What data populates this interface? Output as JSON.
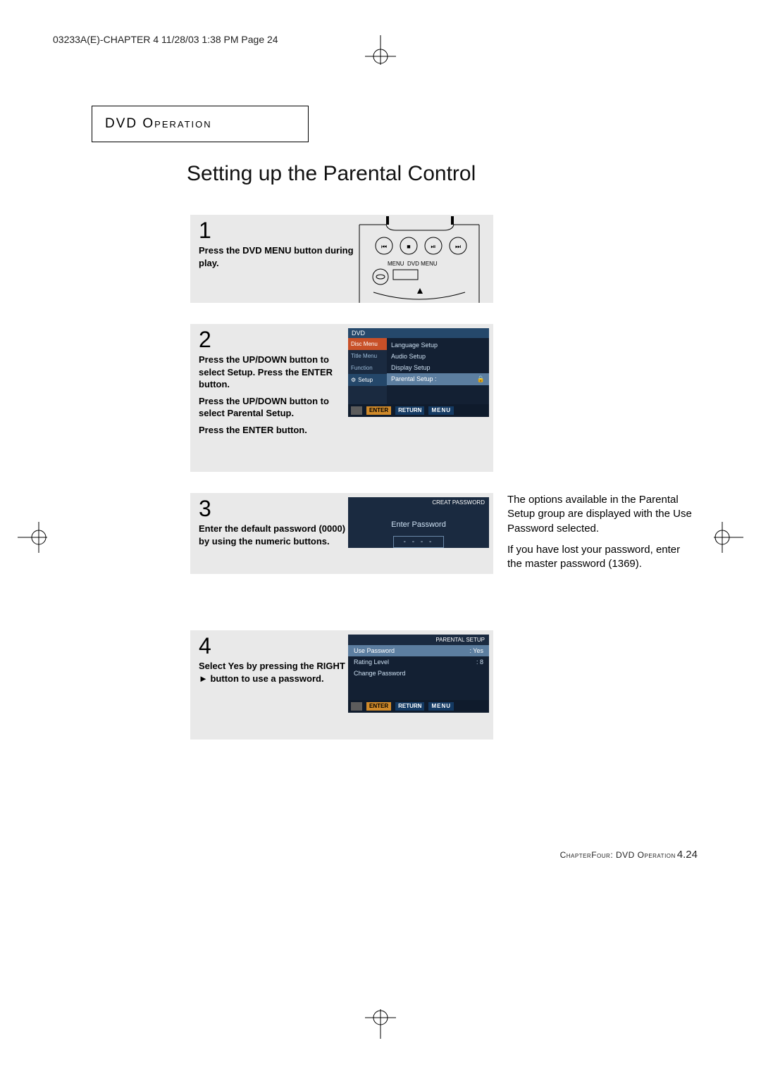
{
  "print_header": "03233A(E)-CHAPTER 4  11/28/03  1:38 PM  Page 24",
  "section_title_prefix": "DVD ",
  "section_title_main": "Operation",
  "page_title": "Setting up the Parental Control",
  "steps": {
    "s1": {
      "num": "1",
      "text": "Press the DVD MENU button during play.",
      "remote_labels": {
        "menu": "MENU",
        "dvdmenu": "DVD MENU"
      }
    },
    "s2": {
      "num": "2",
      "p1": "Press the UP/DOWN button to select Setup. Press the ENTER button.",
      "p2": "Press the UP/DOWN button to select Parental Setup.",
      "p3": "Press the ENTER button.",
      "osd": {
        "top": "DVD",
        "side": [
          "Disc Menu",
          "Title Menu",
          "Function",
          "Setup"
        ],
        "rows": [
          "Language Setup",
          "Audio Setup",
          "Display Setup"
        ],
        "sel": "Parental Setup :",
        "enter": "ENTER",
        "return": "RETURN",
        "menu": "MENU"
      }
    },
    "s3": {
      "num": "3",
      "text": "Enter the default password (0000) by using the numeric buttons.",
      "osd": {
        "title": "CREAT PASSWORD",
        "label": "Enter Password",
        "mask": "-  -  -  -"
      }
    },
    "s4": {
      "num": "4",
      "text_pre": "Select Yes by pressing the RIGHT ",
      "text_post": " button to use a password.",
      "osd": {
        "title": "PARENTAL SETUP",
        "rows": [
          {
            "k": "Use Password",
            "v": ": Yes",
            "sel": true
          },
          {
            "k": "Rating Level",
            "v": ": 8"
          },
          {
            "k": "Change Password",
            "v": ""
          }
        ],
        "enter": "ENTER",
        "return": "RETURN",
        "menu": "MENU"
      }
    }
  },
  "note_p1": "The options available in the Parental Setup group are displayed with the Use Password selected.",
  "note_p2": "If you have lost your password, enter the master password (1369).",
  "footer_chapter": "ChapterFour",
  "footer_section": ": DVD Operation",
  "footer_pagenum": "4.24"
}
